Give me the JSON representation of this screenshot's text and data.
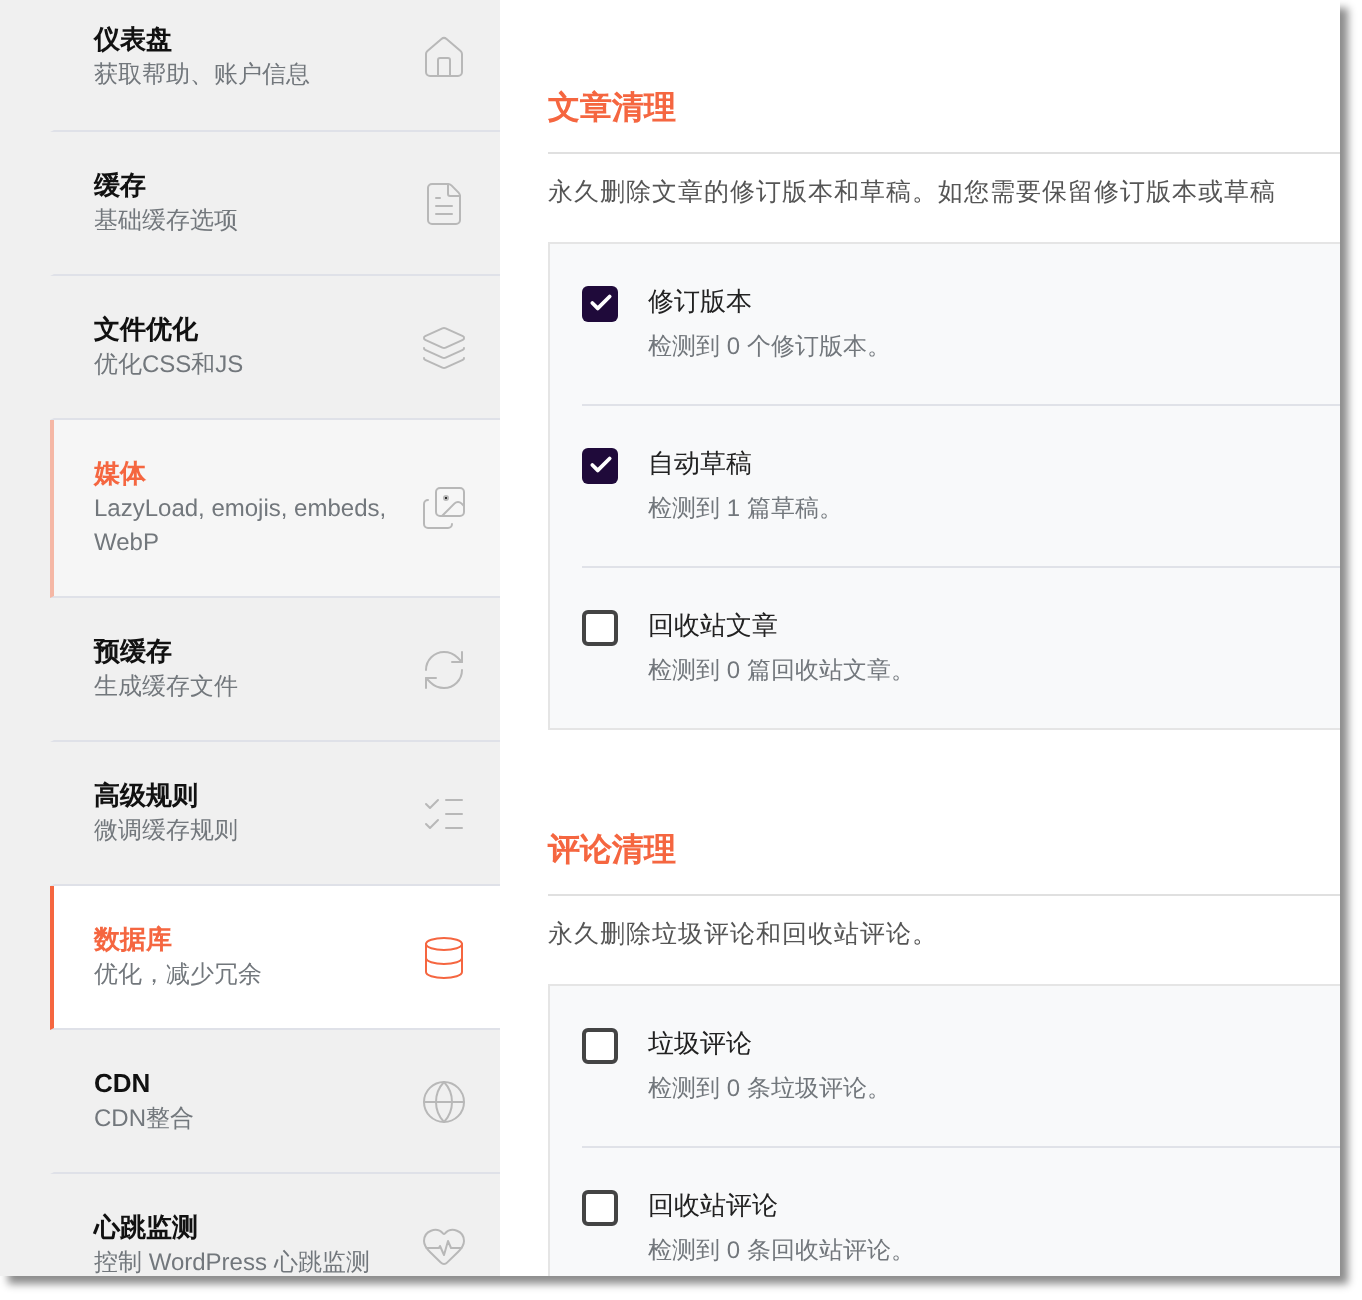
{
  "sidebar": {
    "items": [
      {
        "title": "仪表盘",
        "subtitle": "获取帮助、账户信息",
        "kind": "home",
        "selected": false,
        "hovered": false
      },
      {
        "title": "缓存",
        "subtitle": "基础缓存选项",
        "kind": "file",
        "selected": false,
        "hovered": false
      },
      {
        "title": "文件优化",
        "subtitle": "优化CSS和JS",
        "kind": "layers",
        "selected": false,
        "hovered": false
      },
      {
        "title": "媒体",
        "subtitle": "LazyLoad, emojis, embeds, WebP",
        "kind": "images",
        "selected": false,
        "hovered": true
      },
      {
        "title": "预缓存",
        "subtitle": "生成缓存文件",
        "kind": "refresh",
        "selected": false,
        "hovered": false
      },
      {
        "title": "高级规则",
        "subtitle": "微调缓存规则",
        "kind": "list",
        "selected": false,
        "hovered": false
      },
      {
        "title": "数据库",
        "subtitle": "优化，减少冗余",
        "kind": "database",
        "selected": true,
        "hovered": false
      },
      {
        "title": "CDN",
        "subtitle": "CDN整合",
        "kind": "globe",
        "selected": false,
        "hovered": false
      },
      {
        "title": "心跳监测",
        "subtitle": "控制 WordPress 心跳监测",
        "kind": "heart",
        "selected": false,
        "hovered": false
      }
    ]
  },
  "sections": [
    {
      "title": "文章清理",
      "description": "永久删除文章的修订版本和草稿。如您需要保留修订版本或草稿",
      "options": [
        {
          "label": "修订版本",
          "detail": "检测到 0 个修订版本。",
          "checked": true
        },
        {
          "label": "自动草稿",
          "detail": "检测到 1 篇草稿。",
          "checked": true
        },
        {
          "label": "回收站文章",
          "detail": "检测到 0 篇回收站文章。",
          "checked": false
        }
      ]
    },
    {
      "title": "评论清理",
      "description": "永久删除垃圾评论和回收站评论。",
      "options": [
        {
          "label": "垃圾评论",
          "detail": "检测到 0 条垃圾评论。",
          "checked": false
        },
        {
          "label": "回收站评论",
          "detail": "检测到 0 条回收站评论。",
          "checked": false
        }
      ]
    }
  ]
}
